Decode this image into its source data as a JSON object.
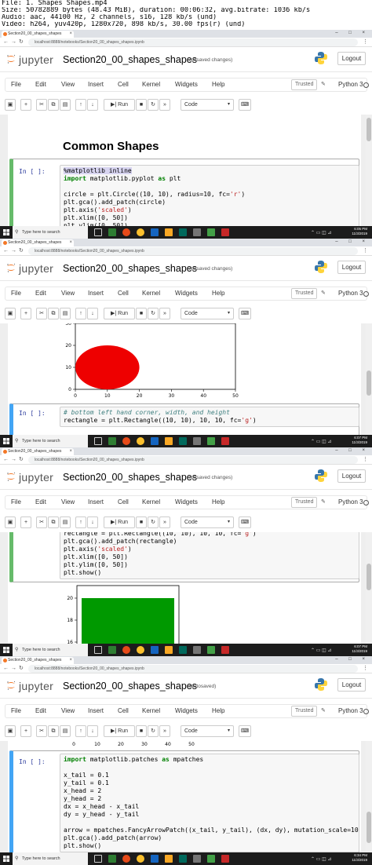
{
  "video_info": {
    "line1": "File: 1. Shapes Shapes.mp4",
    "line2": "Size: 50782889 bytes (48.43 MiB), duration: 00:06:32, avg.bitrate: 1036 kb/s",
    "line3": "Audio: aac, 44100 Hz, 2 channels, s16, 128 kb/s (und)",
    "line4": "Video: h264, yuv420p, 1280x720, 898 kb/s, 30.00 fps(r) (und)"
  },
  "browser": {
    "tab_title": "Section20_00_shapes_shapes",
    "url": "localhost:8888/notebooks/Section20_00_shapes_shapes.ipynb",
    "tab_close": "×",
    "window_controls": "– □ ×"
  },
  "jupyter": {
    "brand": "jupyter",
    "notebook_name": "Section20_00_shapes_shapes",
    "logout_label": "Logout",
    "menu": [
      "File",
      "Edit",
      "View",
      "Insert",
      "Cell",
      "Kernel",
      "Widgets",
      "Help"
    ],
    "trusted_label": "Trusted",
    "kernel_name": "Python 3",
    "run_label": "Run",
    "cell_type": "Code"
  },
  "frames": [
    {
      "status": "(unsaved changes)",
      "heading": "Common Shapes",
      "prompt": "In [ ]:",
      "code_lines": [
        "%matplotlib inline",
        "import matplotlib.pyplot as plt",
        "",
        "circle = plt.Circle((10, 10), radius=10, fc='r')",
        "plt.gca().add_patch(circle)",
        "plt.axis('scaled')",
        "plt.xlim([0, 50])",
        "plt.ylim([0, 50])",
        "plt.show()"
      ],
      "clock_time": "6:05 PM",
      "clock_date": "11/3/2019"
    },
    {
      "status": "(unsaved changes)",
      "prompt": "In [ ]:",
      "code_lines": [
        "# bottom left hand corner, width, and height",
        "rectangle = plt.Rectangle((10, 10), 10, 10, fc='g')"
      ],
      "clock_time": "6:07 PM",
      "clock_date": "11/3/2019"
    },
    {
      "status": "(unsaved changes)",
      "code_lines": [
        "rectangle = plt.Rectangle((10, 10), 10, 10, fc='g')",
        "plt.gca().add_patch(rectangle)",
        "plt.axis('scaled')",
        "plt.xlim([0, 50])",
        "plt.ylim([0, 50])",
        "plt.show()"
      ],
      "clock_time": "6:07 PM",
      "clock_date": "11/3/2019"
    },
    {
      "status": "(autosaved)",
      "prompt": "In [ ]:",
      "code_lines": [
        "import matplotlib.patches as mpatches",
        "",
        "x_tail = 0.1",
        "y_tail = 0.1",
        "x_head = 2",
        "y_head = 2",
        "dx = x_head - x_tail",
        "dy = y_head - y_tail",
        "",
        "arrow = mpatches.FancyArrowPatch((x_tail, y_tail), (dx, dy), mutation_scale=100)",
        "plt.gca().add_patch(arrow)",
        "plt.show()"
      ],
      "clock_time": "6:34 PM",
      "clock_date": "11/3/2019"
    }
  ],
  "taskbar": {
    "search_placeholder": "Type here to search"
  },
  "chart_data": [
    {
      "type": "scatter",
      "description_shape": "circle",
      "center": [
        10,
        10
      ],
      "radius": 10,
      "fill_color": "#ee0000",
      "x_ticks": [
        0,
        10,
        20,
        30,
        40,
        50
      ],
      "y_ticks": [
        0,
        10,
        20,
        30
      ],
      "xlim": [
        0,
        50
      ],
      "ylim": [
        0,
        35
      ]
    },
    {
      "type": "bar",
      "description_shape": "rectangle",
      "fill_color": "#009900",
      "y_ticks": [
        16,
        18,
        20
      ],
      "ylim": [
        15,
        21
      ]
    },
    {
      "type": "line",
      "x_ticks": [
        0,
        10,
        20,
        30,
        40,
        50
      ]
    }
  ],
  "colors": {
    "selected_cell": "#66bb6a",
    "edit_cell": "#42a5f5",
    "jupyter_orange": "#f37726",
    "taskbar": "#1c1c1c"
  }
}
